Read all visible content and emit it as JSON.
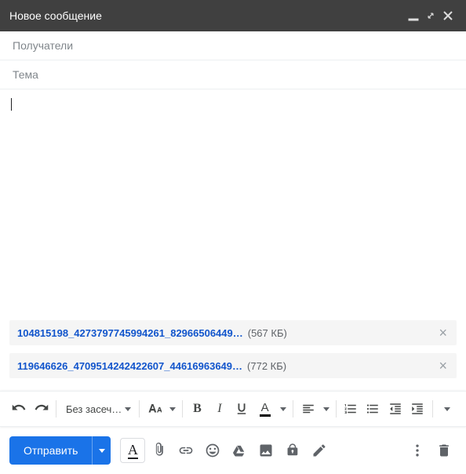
{
  "window": {
    "title": "Новое сообщение"
  },
  "fields": {
    "recipients_placeholder": "Получатели",
    "subject_placeholder": "Тема",
    "recipients_value": "",
    "subject_value": "",
    "body_value": ""
  },
  "attachments": [
    {
      "name": "104815198_4273797745994261_82966506449…",
      "size": "(567 КБ)"
    },
    {
      "name": "119646626_4709514242422607_44616963649…",
      "size": "(772 КБ)"
    }
  ],
  "format_toolbar": {
    "font_label": "Без засеч…"
  },
  "send": {
    "label": "Отправить"
  }
}
